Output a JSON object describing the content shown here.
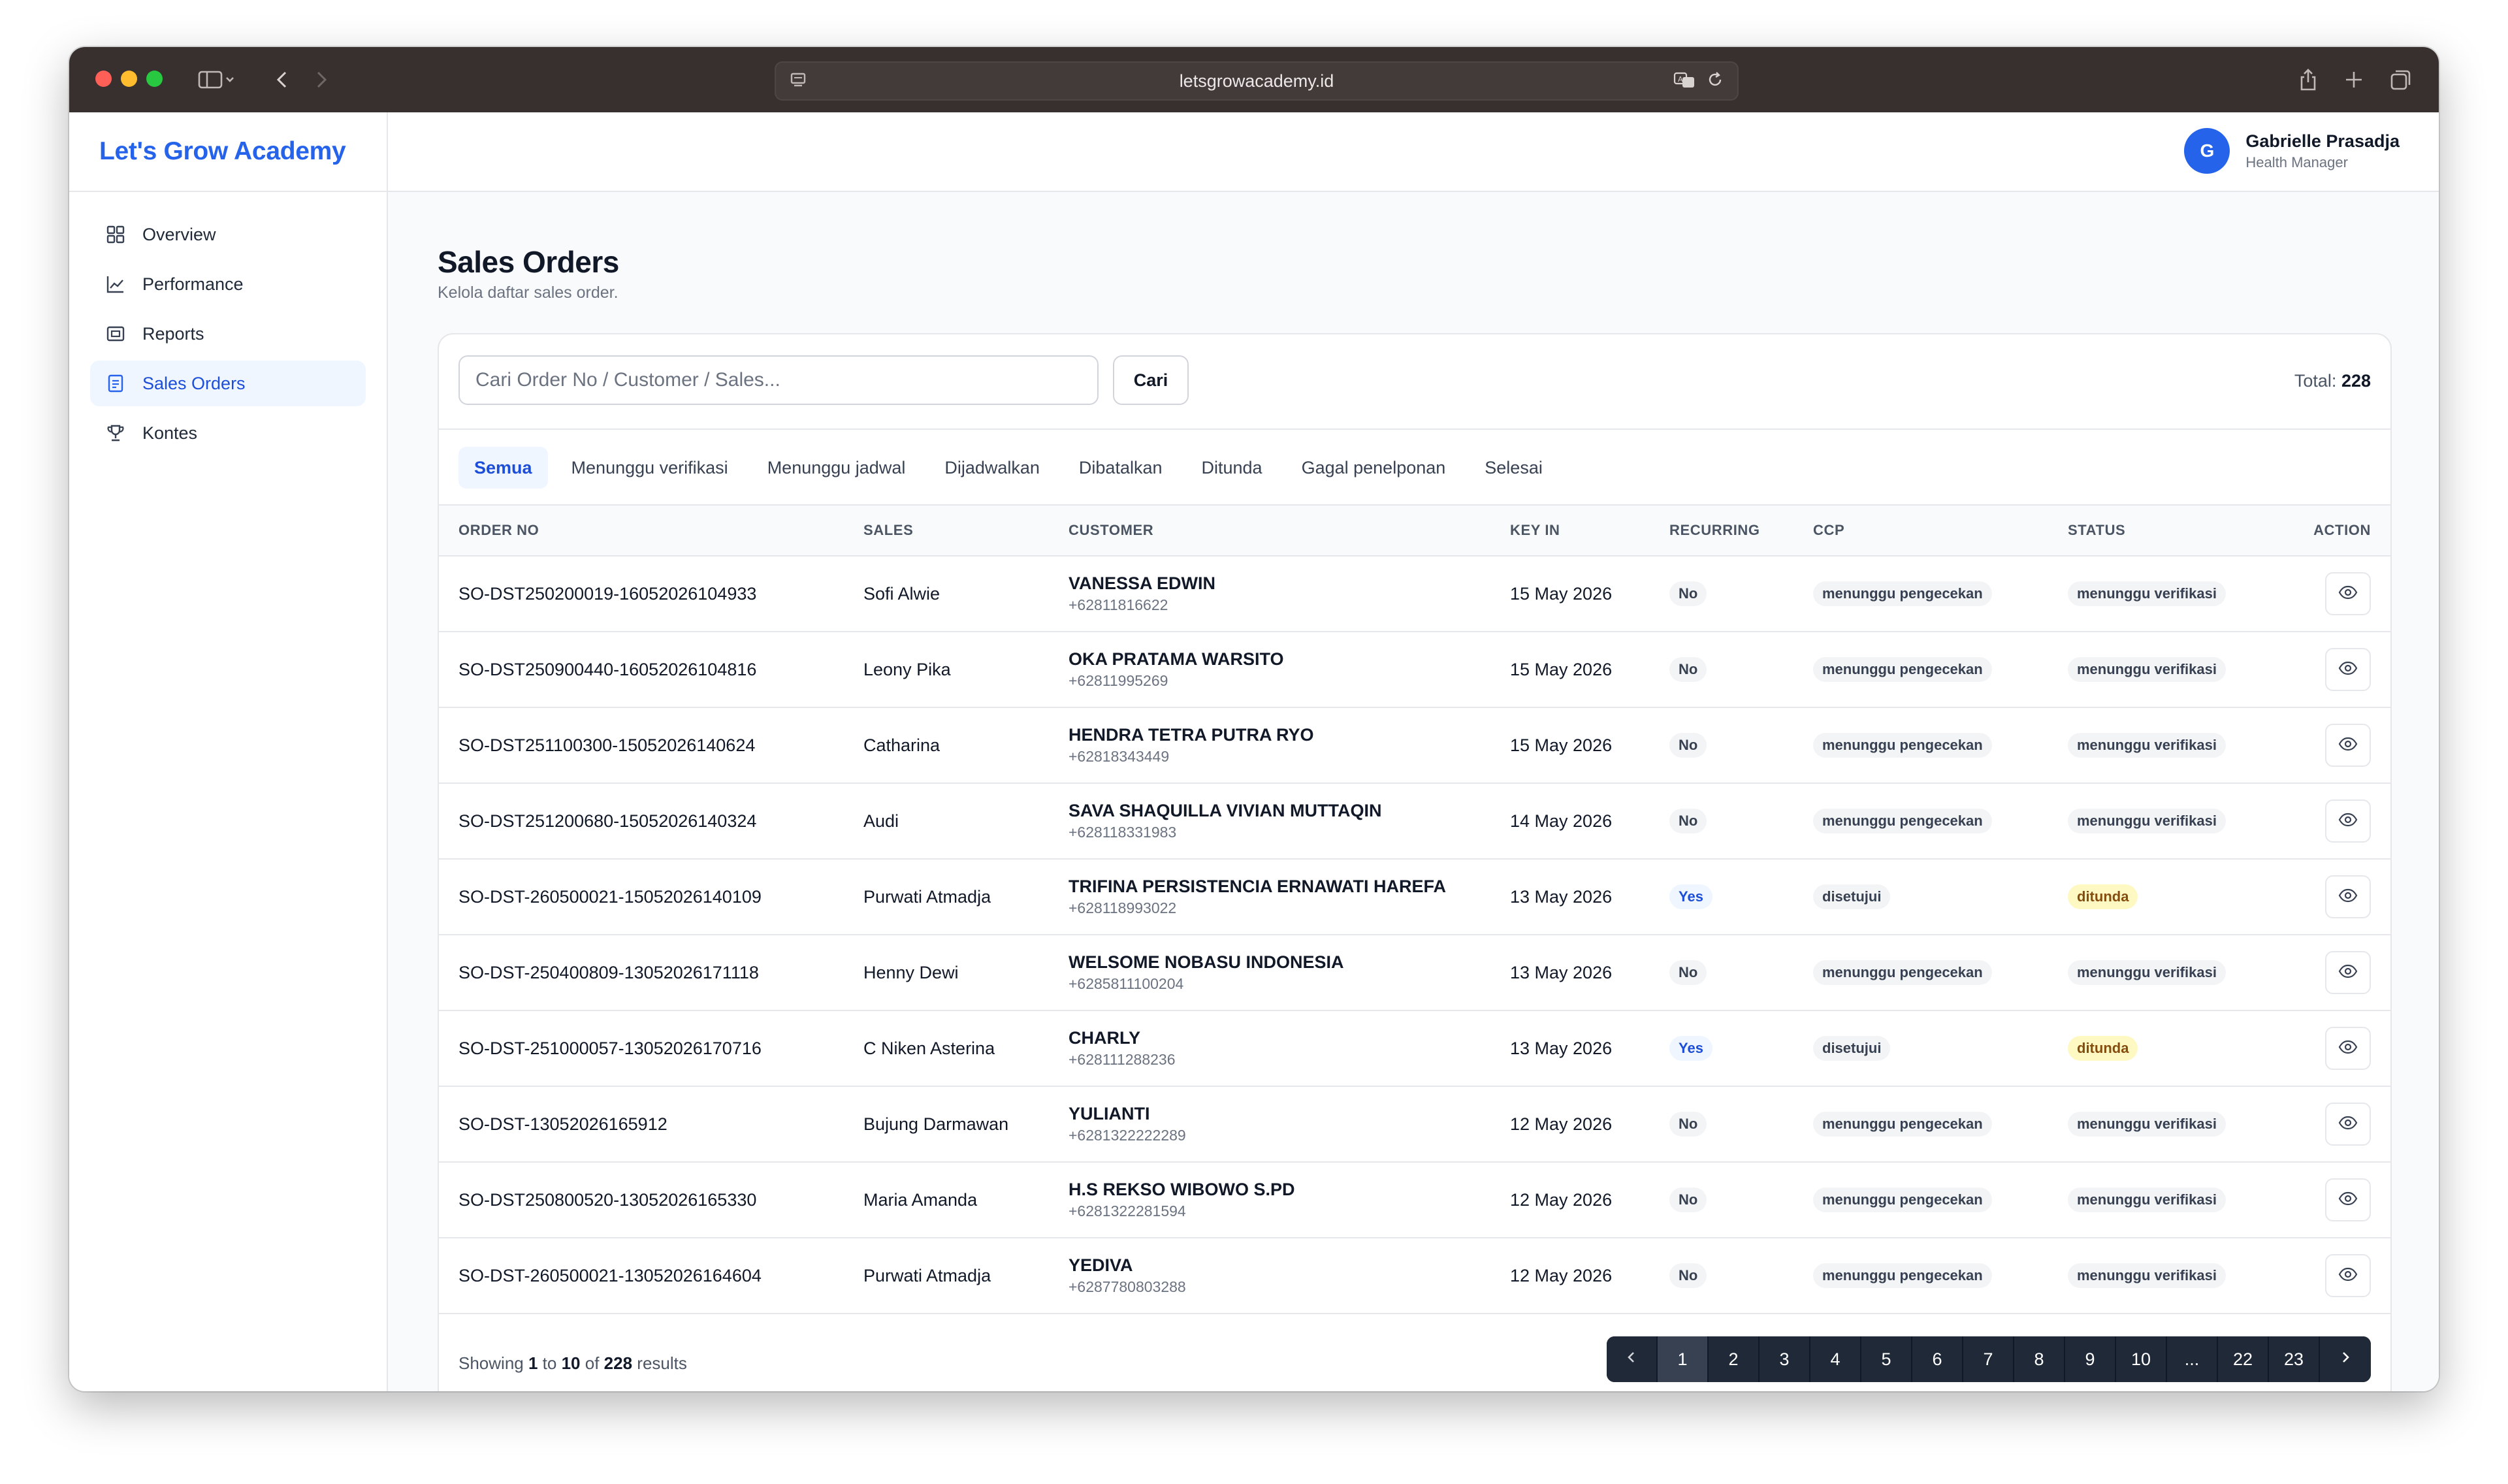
{
  "browser": {
    "url": "letsgrowacademy.id"
  },
  "brand": "Let's Grow Academy",
  "user": {
    "initial": "G",
    "name": "Gabrielle Prasadja",
    "role": "Health Manager"
  },
  "sidebar": {
    "items": [
      {
        "label": "Overview",
        "icon": "grid-icon"
      },
      {
        "label": "Performance",
        "icon": "line-chart-icon"
      },
      {
        "label": "Reports",
        "icon": "report-icon"
      },
      {
        "label": "Sales Orders",
        "icon": "document-icon",
        "active": true
      },
      {
        "label": "Kontes",
        "icon": "trophy-icon"
      }
    ]
  },
  "page": {
    "title": "Sales Orders",
    "subtitle": "Kelola daftar sales order."
  },
  "search": {
    "placeholder": "Cari Order No / Customer / Sales...",
    "button": "Cari",
    "total_label": "Total:",
    "total_value": "228"
  },
  "tabs": [
    {
      "label": "Semua",
      "active": true
    },
    {
      "label": "Menunggu verifikasi"
    },
    {
      "label": "Menunggu jadwal"
    },
    {
      "label": "Dijadwalkan"
    },
    {
      "label": "Dibatalkan"
    },
    {
      "label": "Ditunda"
    },
    {
      "label": "Gagal penelponan"
    },
    {
      "label": "Selesai"
    }
  ],
  "table": {
    "headers": [
      "ORDER NO",
      "SALES",
      "CUSTOMER",
      "KEY IN",
      "RECURRING",
      "CCP",
      "STATUS",
      "ACTION"
    ],
    "rows": [
      {
        "order_no": "SO-DST250200019-16052026104933",
        "sales": "Sofi Alwie",
        "customer": "VANESSA EDWIN",
        "phone": "+62811816622",
        "key_in": "15 May 2026",
        "recurring": "No",
        "ccp": "menunggu pengecekan",
        "status": "menunggu verifikasi"
      },
      {
        "order_no": "SO-DST250900440-16052026104816",
        "sales": "Leony Pika",
        "customer": "OKA PRATAMA WARSITO",
        "phone": "+62811995269",
        "key_in": "15 May 2026",
        "recurring": "No",
        "ccp": "menunggu pengecekan",
        "status": "menunggu verifikasi"
      },
      {
        "order_no": "SO-DST251100300-15052026140624",
        "sales": "Catharina",
        "customer": "HENDRA TETRA PUTRA RYO",
        "phone": "+62818343449",
        "key_in": "15 May 2026",
        "recurring": "No",
        "ccp": "menunggu pengecekan",
        "status": "menunggu verifikasi"
      },
      {
        "order_no": "SO-DST251200680-15052026140324",
        "sales": "Audi",
        "customer": "SAVA SHAQUILLA VIVIAN MUTTAQIN",
        "phone": "+628118331983",
        "key_in": "14 May 2026",
        "recurring": "No",
        "ccp": "menunggu pengecekan",
        "status": "menunggu verifikasi"
      },
      {
        "order_no": "SO-DST-260500021-15052026140109",
        "sales": "Purwati Atmadja",
        "customer": "TRIFINA PERSISTENCIA ERNAWATI HAREFA",
        "phone": "+628118993022",
        "key_in": "13 May 2026",
        "recurring": "Yes",
        "ccp": "disetujui",
        "status": "ditunda"
      },
      {
        "order_no": "SO-DST-250400809-13052026171118",
        "sales": "Henny Dewi",
        "customer": "WELSOME NOBASU INDONESIA",
        "phone": "+6285811100204",
        "key_in": "13 May 2026",
        "recurring": "No",
        "ccp": "menunggu pengecekan",
        "status": "menunggu verifikasi"
      },
      {
        "order_no": "SO-DST-251000057-13052026170716",
        "sales": "C Niken Asterina",
        "customer": "CHARLY",
        "phone": "+628111288236",
        "key_in": "13 May 2026",
        "recurring": "Yes",
        "ccp": "disetujui",
        "status": "ditunda"
      },
      {
        "order_no": "SO-DST-13052026165912",
        "sales": "Bujung Darmawan",
        "customer": "YULIANTI",
        "phone": "+6281322222289",
        "key_in": "12 May 2026",
        "recurring": "No",
        "ccp": "menunggu pengecekan",
        "status": "menunggu verifikasi"
      },
      {
        "order_no": "SO-DST250800520-13052026165330",
        "sales": "Maria Amanda",
        "customer": "H.S REKSO WIBOWO S.PD",
        "phone": "+6281322281594",
        "key_in": "12 May 2026",
        "recurring": "No",
        "ccp": "menunggu pengecekan",
        "status": "menunggu verifikasi"
      },
      {
        "order_no": "SO-DST-260500021-13052026164604",
        "sales": "Purwati Atmadja",
        "customer": "YEDIVA",
        "phone": "+6287780803288",
        "key_in": "12 May 2026",
        "recurring": "No",
        "ccp": "menunggu pengecekan",
        "status": "menunggu verifikasi"
      }
    ]
  },
  "footer": {
    "showing_prefix": "Showing",
    "from": "1",
    "to_word": "to",
    "to": "10",
    "of_word": "of",
    "total": "228",
    "results_word": "results"
  },
  "pagination": {
    "pages": [
      "1",
      "2",
      "3",
      "4",
      "5",
      "6",
      "7",
      "8",
      "9",
      "10",
      "...",
      "22",
      "23"
    ],
    "current": "1"
  },
  "colors": {
    "accent": "#2563eb",
    "active_bg": "#eff6ff",
    "yes_pill": "#1d4ed8",
    "ditunda_pill_bg": "#fef9c3",
    "ditunda_pill_text": "#854d0e",
    "pager_bg": "#1f2937"
  }
}
